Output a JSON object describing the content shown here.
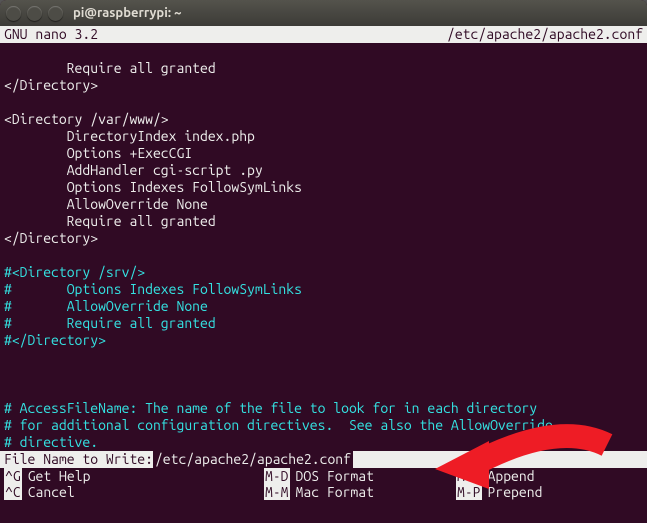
{
  "window": {
    "title": "pi@raspberrypi: ~"
  },
  "nano": {
    "appver": "GNU nano 3.2",
    "filepath": "/etc/apache2/apache2.conf"
  },
  "content": {
    "l01": "        Require all granted",
    "l02": "</Directory>",
    "l03": "",
    "l04": "<Directory /var/www/>",
    "l05": "        DirectoryIndex index.php",
    "l06": "        Options +ExecCGI",
    "l07": "        AddHandler cgi-script .py",
    "l08": "        Options Indexes FollowSymLinks",
    "l09": "        AllowOverride None",
    "l10": "        Require all granted",
    "l11": "</Directory>",
    "l12": "",
    "l13": "#<Directory /srv/>",
    "l14": "#       Options Indexes FollowSymLinks",
    "l15": "#       AllowOverride None",
    "l16": "#       Require all granted",
    "l17": "#</Directory>",
    "l18": "",
    "l19": "",
    "l20": "",
    "l21": "# AccessFileName: The name of the file to look for in each directory",
    "l22": "# for additional configuration directives.  See also the AllowOverride",
    "l23": "# directive."
  },
  "prompt": {
    "label": "File Name to Write: ",
    "value": "/etc/apache2/apache2.conf"
  },
  "shortcuts": {
    "r1c1k": "^G",
    "r1c1l": "Get Help",
    "r1c2k": "M-D",
    "r1c2l": "DOS Format",
    "r1c3k": "M-A",
    "r1c3l": "Append",
    "r2c1k": "^C",
    "r2c1l": "Cancel",
    "r2c2k": "M-M",
    "r2c2l": "Mac Format",
    "r2c3k": "M-P",
    "r2c3l": "Prepend"
  }
}
